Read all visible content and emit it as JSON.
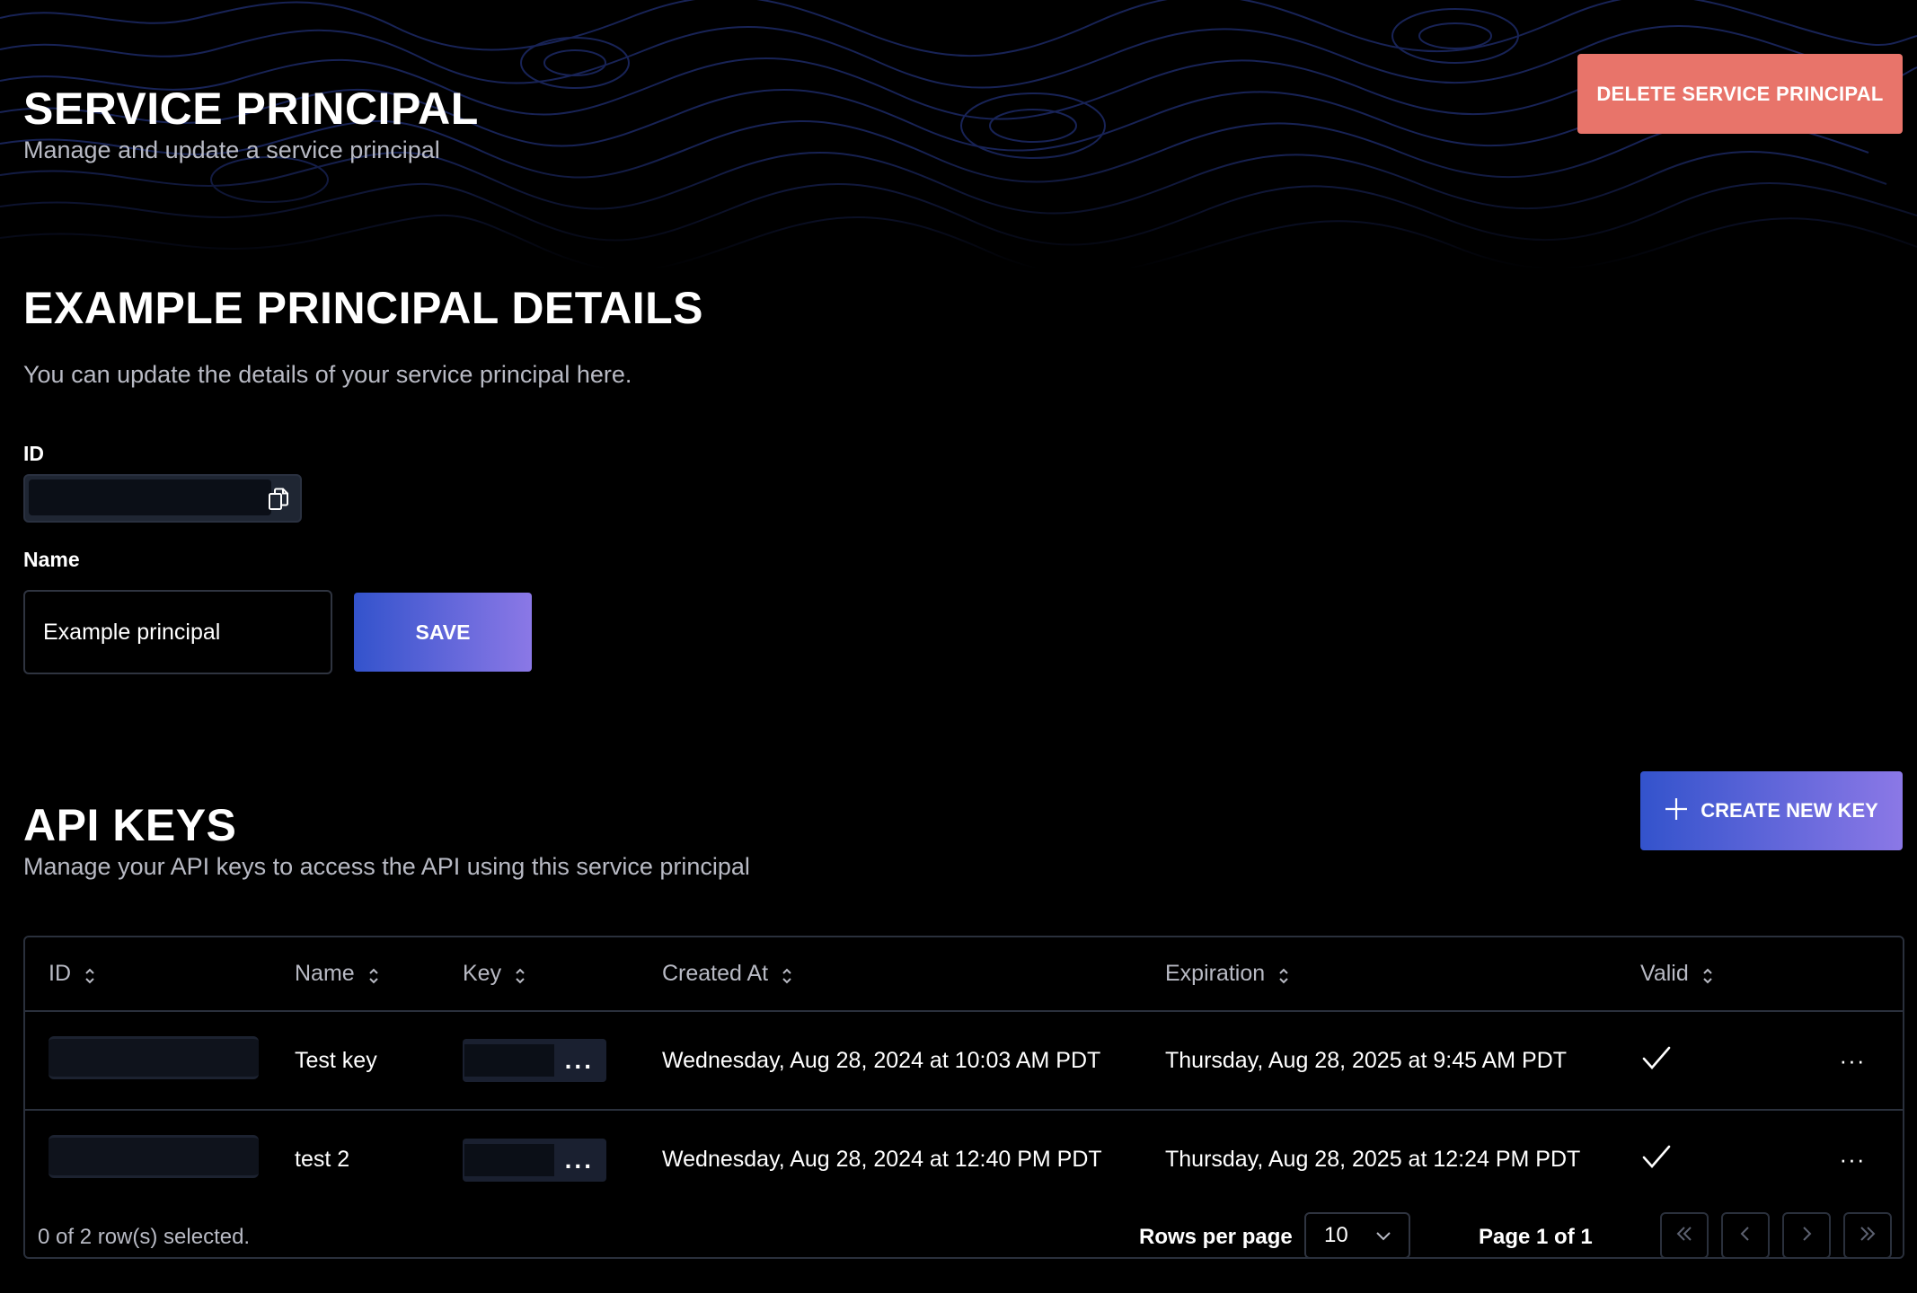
{
  "header": {
    "title": "SERVICE PRINCIPAL",
    "subtitle": "Manage and update a service principal",
    "delete_label": "DELETE SERVICE PRINCIPAL"
  },
  "details": {
    "title": "EXAMPLE PRINCIPAL DETAILS",
    "description": "You can update the details of your service principal here.",
    "id_label": "ID",
    "name_label": "Name",
    "name_value": "Example principal",
    "save_label": "SAVE"
  },
  "api_keys": {
    "title": "API KEYS",
    "description": "Manage your API keys to access the API using this service principal",
    "create_label": "CREATE NEW KEY",
    "columns": [
      "ID",
      "Name",
      "Key",
      "Created At",
      "Expiration",
      "Valid"
    ],
    "rows": [
      {
        "name": "Test key",
        "created_at": "Wednesday, Aug 28, 2024 at 10:03 AM PDT",
        "expiration": "Thursday, Aug 28, 2025 at 9:45 AM PDT",
        "valid": true
      },
      {
        "name": "test 2",
        "created_at": "Wednesday, Aug 28, 2024 at 12:40 PM PDT",
        "expiration": "Thursday, Aug 28, 2025 at 12:24 PM PDT",
        "valid": true
      }
    ],
    "key_dots": "...",
    "row_menu": "···",
    "footer": {
      "selected_text": "0 of 2 row(s) selected.",
      "rows_per_page_label": "Rows per page",
      "rows_per_page_value": "10",
      "page_text": "Page 1 of 1"
    }
  },
  "icons": {
    "copy": "copy-icon",
    "sort": "sort-icon",
    "check": "check-icon",
    "more": "more-icon",
    "plus": "plus-icon",
    "chevron": "chevron-down-icon"
  },
  "colors": {
    "background": "#000000",
    "danger": "#e8746a",
    "primary_gradient_start": "#3353cc",
    "primary_gradient_end": "#8b78e6",
    "border": "#2a303c",
    "muted_text": "#b8bac4",
    "topo_line": "#1d2a66"
  }
}
